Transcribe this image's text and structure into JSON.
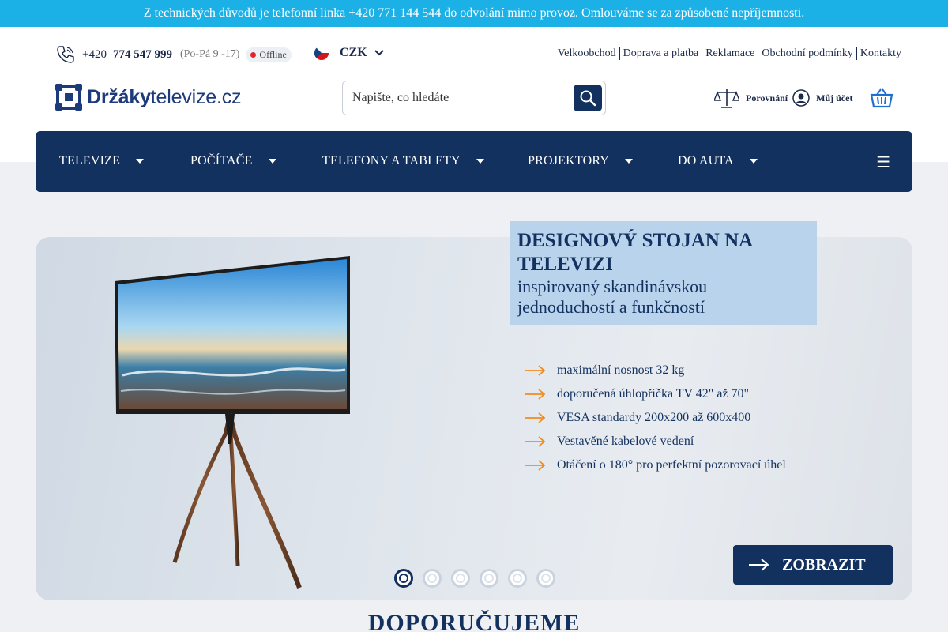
{
  "topbar": {
    "message": "Z technických důvodů je telefonní linka +420 771 144 544 do odvolání mimo provoz. Omlouváme se za způsobené nepříjemnosti."
  },
  "contact": {
    "prefix": "+420",
    "number": "774 547 999",
    "hours": "(Po-Pá 9 -17)",
    "status": "Offline"
  },
  "currency": {
    "code": "CZK"
  },
  "toplinks": [
    "Velkoobchod",
    "Doprava a platba",
    "Reklamace",
    "Obchodní podmínky",
    "Kontakty"
  ],
  "logo": {
    "bold": "Držáky",
    "light": "televize.cz"
  },
  "search": {
    "placeholder": "Napište, co hledáte"
  },
  "actions": {
    "compare": "Porovnání",
    "account": "Můj účet"
  },
  "nav": {
    "items": [
      "TELEVIZE",
      "POČÍTAČE",
      "TELEFONY A TABLETY",
      "PROJEKTORY",
      "DO AUTA"
    ],
    "menu_icon": "hamburger-icon"
  },
  "banner": {
    "title": "DESIGNOVÝ STOJAN NA TELEVIZI",
    "subtitle": "inspirovaný skandinávskou jednoduchostí a funkčností",
    "features": [
      "maximální nosnost 32 kg",
      "doporučená úhlopříčka TV 42\" až 70\"",
      "VESA standardy 200x200 až 600x400",
      "Vestavěné kabelové vedení",
      "Otáčení o 180° pro perfektní pozorovací úhel"
    ],
    "cta": "ZOBRAZIT",
    "slides": 6,
    "active_slide": 1
  },
  "section": {
    "title": "DOPORUČUJEME"
  },
  "colors": {
    "topbar": "#1bb0e6",
    "navy": "#13315f",
    "accent_orange": "#f28c1f",
    "promo_bg": "#b9d3ec"
  }
}
